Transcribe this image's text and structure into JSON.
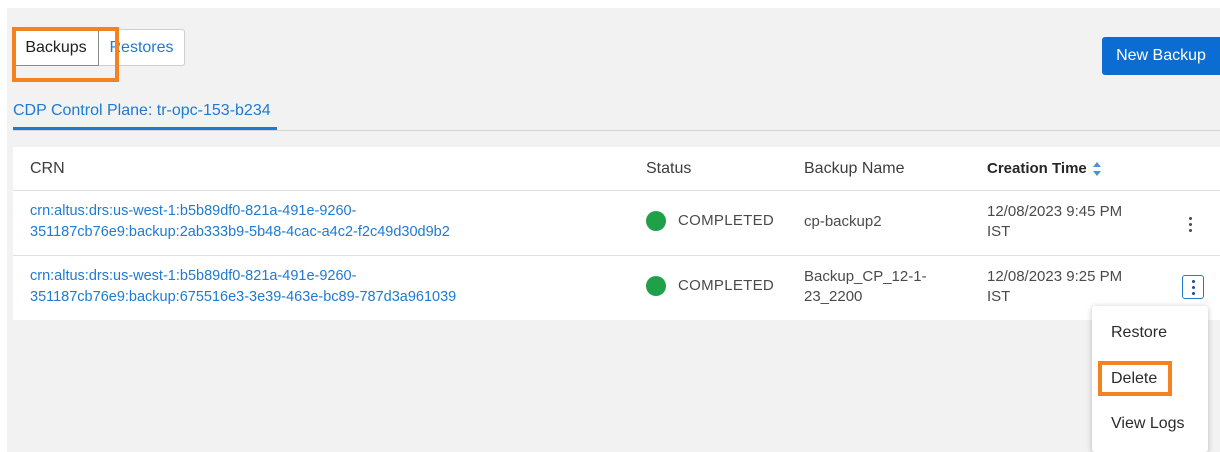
{
  "tabs": [
    {
      "label": "Backups"
    },
    {
      "label": "Restores"
    }
  ],
  "actions": {
    "new_backup_label": "New Backup"
  },
  "control_plane_tab": {
    "label": "CDP Control Plane: tr-opc-153-b234"
  },
  "table": {
    "columns": [
      "CRN",
      "Status",
      "Backup Name",
      "Creation Time"
    ],
    "sort_column": "Creation Time",
    "rows": [
      {
        "crn_line1": "crn:altus:drs:us-west-1:b5b89df0-821a-491e-9260-",
        "crn_line2": "351187cb76e9:backup:2ab333b9-5b48-4cac-a4c2-f2c49d30d9b2",
        "status": "COMPLETED",
        "backup_name_line1": "cp-backup2",
        "backup_name_line2": "",
        "time_line1": "12/08/2023 9:45 PM",
        "time_line2": "IST"
      },
      {
        "crn_line1": "crn:altus:drs:us-west-1:b5b89df0-821a-491e-9260-",
        "crn_line2": "351187cb76e9:backup:675516e3-3e39-463e-bc89-787d3a961039",
        "status": "COMPLETED",
        "backup_name_line1": "Backup_CP_12-1-",
        "backup_name_line2": "23_2200",
        "time_line1": "12/08/2023 9:25 PM",
        "time_line2": "IST"
      }
    ]
  },
  "context_menu": {
    "items": [
      "Restore",
      "Delete",
      "View Logs"
    ]
  },
  "colors": {
    "accent": "#1f7ad1",
    "primary_button": "#0b6dd1",
    "status_completed": "#21a04a",
    "highlight": "#f58220"
  },
  "icons": [
    "kebab-menu-icon",
    "sort-icon",
    "status-dot-icon"
  ]
}
